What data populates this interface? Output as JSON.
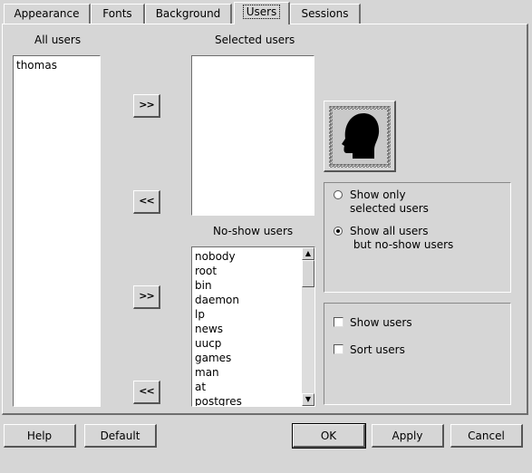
{
  "tabs": [
    {
      "label": "Appearance",
      "active": false
    },
    {
      "label": "Fonts",
      "active": false
    },
    {
      "label": "Background",
      "active": false
    },
    {
      "label": "Users",
      "active": true
    },
    {
      "label": "Sessions",
      "active": false
    }
  ],
  "all_users": {
    "heading": "All users",
    "items": [
      "thomas"
    ]
  },
  "selected_users": {
    "heading": "Selected users",
    "items": []
  },
  "no_show_users": {
    "heading": "No-show users",
    "items": [
      "nobody",
      "root",
      "bin",
      "daemon",
      "lp",
      "news",
      "uucp",
      "games",
      "man",
      "at",
      "postgres"
    ]
  },
  "transfer_buttons": {
    "add_selected": ">>",
    "remove_selected": "<<",
    "add_noshow": ">>",
    "remove_noshow": "<<"
  },
  "radio_options": [
    {
      "label": "Show only\nselected users",
      "checked": false
    },
    {
      "label": "Show all users\n but no-show users",
      "checked": true
    }
  ],
  "checkboxes": [
    {
      "label": "Show users",
      "checked": false
    },
    {
      "label": "Sort users",
      "checked": false
    }
  ],
  "footer": {
    "help": "Help",
    "default": "Default",
    "ok": "OK",
    "apply": "Apply",
    "cancel": "Cancel"
  },
  "colors": {
    "window_bg": "#d6d6d6",
    "list_bg": "#ffffff",
    "shadow": "#6e6e6e",
    "highlight": "#ffffff"
  }
}
